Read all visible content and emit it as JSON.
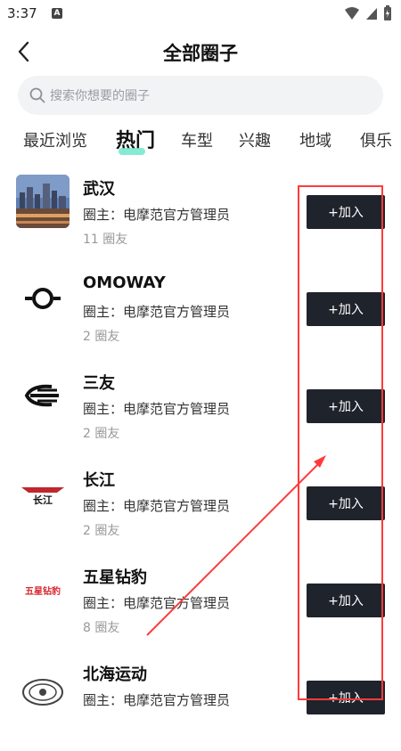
{
  "status_bar": {
    "time": "3:37",
    "notif_glyph": "A"
  },
  "header": {
    "title": "全部圈子"
  },
  "search": {
    "placeholder": "搜索你想要的圈子"
  },
  "tabs": [
    {
      "label": "最近浏览",
      "active": false
    },
    {
      "label": "热门",
      "active": true
    },
    {
      "label": "车型",
      "active": false
    },
    {
      "label": "兴趣",
      "active": false
    },
    {
      "label": "地域",
      "active": false
    },
    {
      "label": "俱乐",
      "active": false
    }
  ],
  "circles": [
    {
      "name": "武汉",
      "owner": "圈主：电摩范官方管理员",
      "members": "11 圈友",
      "join_label": "+加入",
      "icon": "wuhan-city-photo"
    },
    {
      "name": "OMOWAY",
      "owner": "圈主：电摩范官方管理员",
      "members": "2 圈友",
      "join_label": "+加入",
      "icon": "omoway-logo"
    },
    {
      "name": "三友",
      "owner": "圈主：电摩范官方管理员",
      "members": "2 圈友",
      "join_label": "+加入",
      "icon": "sanyou-logo"
    },
    {
      "name": "长江",
      "owner": "圈主：电摩范官方管理员",
      "members": "2 圈友",
      "join_label": "+加入",
      "icon": "changjiang-logo",
      "logo_text": "长江"
    },
    {
      "name": "五星钻豹",
      "owner": "圈主：电摩范官方管理员",
      "members": "8 圈友",
      "join_label": "+加入",
      "icon": "wuxingzuanbao-logo",
      "logo_text": "五星钻豹"
    },
    {
      "name": "北海运动",
      "owner": "圈主：电摩范官方管理员",
      "members": "",
      "join_label": "+加入",
      "icon": "beihai-logo"
    }
  ],
  "colors": {
    "join_button_bg": "#1f232b",
    "annotation": "#ff3b3b",
    "tab_indicator": "#69e6c8"
  }
}
